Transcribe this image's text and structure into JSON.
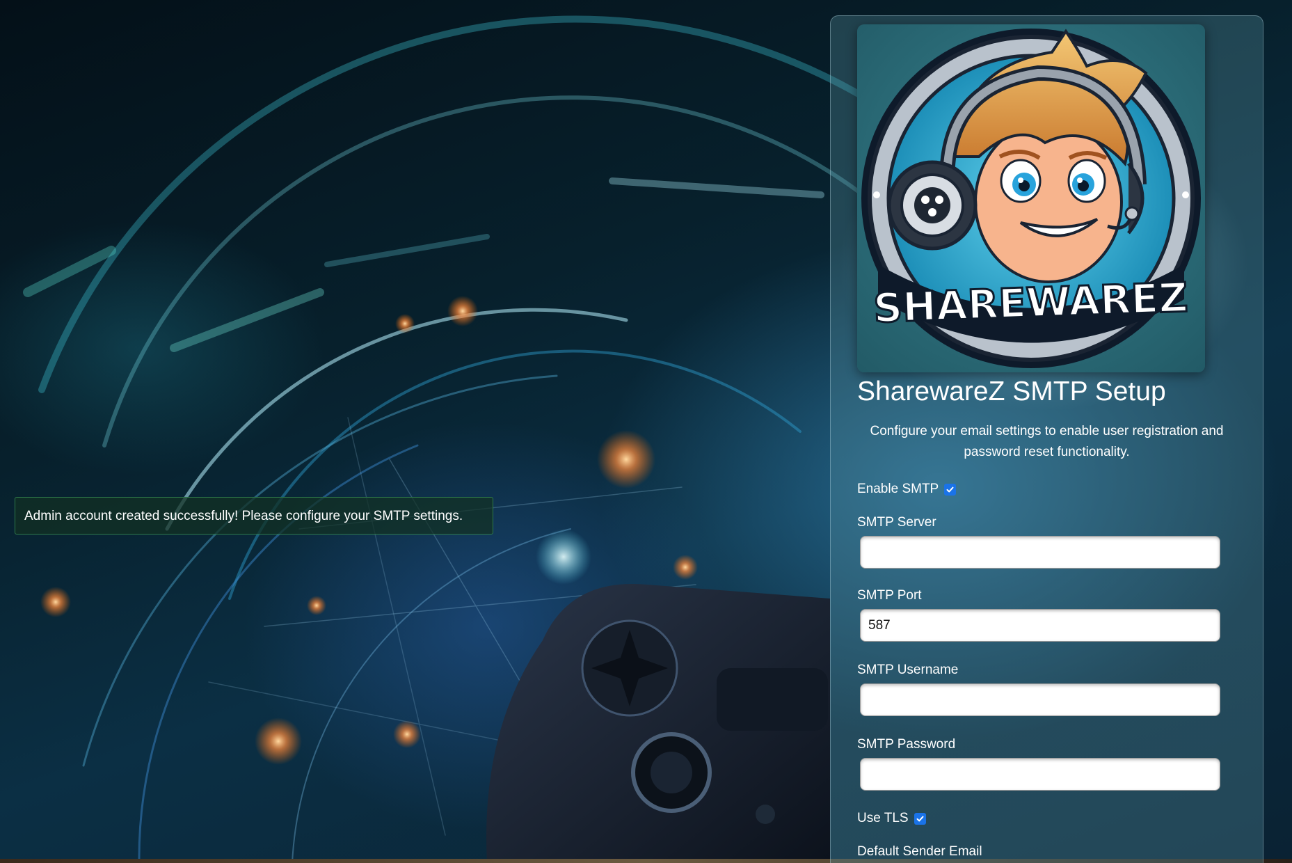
{
  "flash": {
    "message": "Admin account created successfully! Please configure your SMTP settings."
  },
  "logo": {
    "wordmark": "SHAREWAREZ"
  },
  "setup": {
    "title": "SharewareZ SMTP Setup",
    "description": "Configure your email settings to enable user registration and password reset functionality.",
    "enable_smtp": {
      "label": "Enable SMTP",
      "checked": true
    },
    "smtp_server": {
      "label": "SMTP Server",
      "value": ""
    },
    "smtp_port": {
      "label": "SMTP Port",
      "value": "587"
    },
    "smtp_username": {
      "label": "SMTP Username",
      "value": ""
    },
    "smtp_password": {
      "label": "SMTP Password",
      "value": ""
    },
    "use_tls": {
      "label": "Use TLS",
      "checked": true
    },
    "default_sender_email": {
      "label": "Default Sender Email"
    }
  },
  "colors": {
    "checkbox_accent": "#1a73e8",
    "flash_border": "#2f7a4a",
    "panel_tint": "#5a96a5"
  }
}
